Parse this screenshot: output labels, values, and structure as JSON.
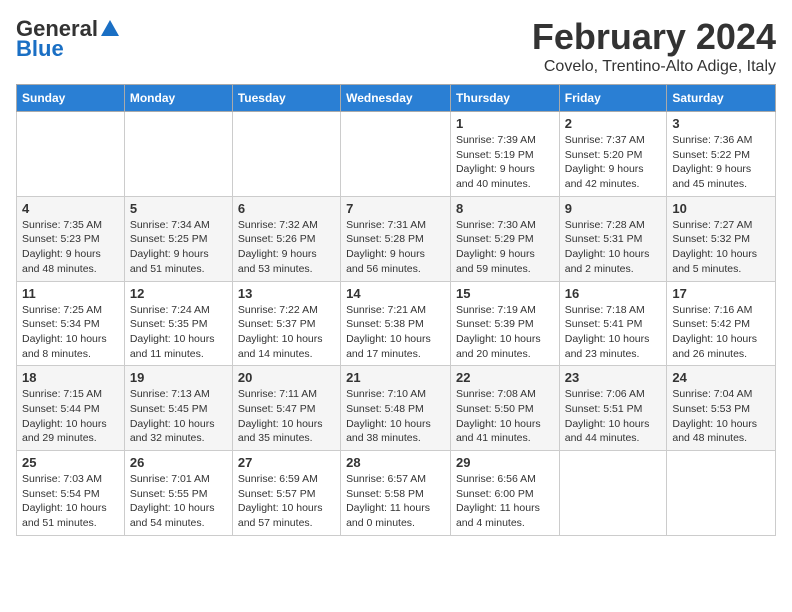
{
  "header": {
    "logo_general": "General",
    "logo_blue": "Blue",
    "month_title": "February 2024",
    "subtitle": "Covelo, Trentino-Alto Adige, Italy"
  },
  "days_of_week": [
    "Sunday",
    "Monday",
    "Tuesday",
    "Wednesday",
    "Thursday",
    "Friday",
    "Saturday"
  ],
  "weeks": [
    [
      {
        "day": "",
        "info": ""
      },
      {
        "day": "",
        "info": ""
      },
      {
        "day": "",
        "info": ""
      },
      {
        "day": "",
        "info": ""
      },
      {
        "day": "1",
        "info": "Sunrise: 7:39 AM\nSunset: 5:19 PM\nDaylight: 9 hours and 40 minutes."
      },
      {
        "day": "2",
        "info": "Sunrise: 7:37 AM\nSunset: 5:20 PM\nDaylight: 9 hours and 42 minutes."
      },
      {
        "day": "3",
        "info": "Sunrise: 7:36 AM\nSunset: 5:22 PM\nDaylight: 9 hours and 45 minutes."
      }
    ],
    [
      {
        "day": "4",
        "info": "Sunrise: 7:35 AM\nSunset: 5:23 PM\nDaylight: 9 hours and 48 minutes."
      },
      {
        "day": "5",
        "info": "Sunrise: 7:34 AM\nSunset: 5:25 PM\nDaylight: 9 hours and 51 minutes."
      },
      {
        "day": "6",
        "info": "Sunrise: 7:32 AM\nSunset: 5:26 PM\nDaylight: 9 hours and 53 minutes."
      },
      {
        "day": "7",
        "info": "Sunrise: 7:31 AM\nSunset: 5:28 PM\nDaylight: 9 hours and 56 minutes."
      },
      {
        "day": "8",
        "info": "Sunrise: 7:30 AM\nSunset: 5:29 PM\nDaylight: 9 hours and 59 minutes."
      },
      {
        "day": "9",
        "info": "Sunrise: 7:28 AM\nSunset: 5:31 PM\nDaylight: 10 hours and 2 minutes."
      },
      {
        "day": "10",
        "info": "Sunrise: 7:27 AM\nSunset: 5:32 PM\nDaylight: 10 hours and 5 minutes."
      }
    ],
    [
      {
        "day": "11",
        "info": "Sunrise: 7:25 AM\nSunset: 5:34 PM\nDaylight: 10 hours and 8 minutes."
      },
      {
        "day": "12",
        "info": "Sunrise: 7:24 AM\nSunset: 5:35 PM\nDaylight: 10 hours and 11 minutes."
      },
      {
        "day": "13",
        "info": "Sunrise: 7:22 AM\nSunset: 5:37 PM\nDaylight: 10 hours and 14 minutes."
      },
      {
        "day": "14",
        "info": "Sunrise: 7:21 AM\nSunset: 5:38 PM\nDaylight: 10 hours and 17 minutes."
      },
      {
        "day": "15",
        "info": "Sunrise: 7:19 AM\nSunset: 5:39 PM\nDaylight: 10 hours and 20 minutes."
      },
      {
        "day": "16",
        "info": "Sunrise: 7:18 AM\nSunset: 5:41 PM\nDaylight: 10 hours and 23 minutes."
      },
      {
        "day": "17",
        "info": "Sunrise: 7:16 AM\nSunset: 5:42 PM\nDaylight: 10 hours and 26 minutes."
      }
    ],
    [
      {
        "day": "18",
        "info": "Sunrise: 7:15 AM\nSunset: 5:44 PM\nDaylight: 10 hours and 29 minutes."
      },
      {
        "day": "19",
        "info": "Sunrise: 7:13 AM\nSunset: 5:45 PM\nDaylight: 10 hours and 32 minutes."
      },
      {
        "day": "20",
        "info": "Sunrise: 7:11 AM\nSunset: 5:47 PM\nDaylight: 10 hours and 35 minutes."
      },
      {
        "day": "21",
        "info": "Sunrise: 7:10 AM\nSunset: 5:48 PM\nDaylight: 10 hours and 38 minutes."
      },
      {
        "day": "22",
        "info": "Sunrise: 7:08 AM\nSunset: 5:50 PM\nDaylight: 10 hours and 41 minutes."
      },
      {
        "day": "23",
        "info": "Sunrise: 7:06 AM\nSunset: 5:51 PM\nDaylight: 10 hours and 44 minutes."
      },
      {
        "day": "24",
        "info": "Sunrise: 7:04 AM\nSunset: 5:53 PM\nDaylight: 10 hours and 48 minutes."
      }
    ],
    [
      {
        "day": "25",
        "info": "Sunrise: 7:03 AM\nSunset: 5:54 PM\nDaylight: 10 hours and 51 minutes."
      },
      {
        "day": "26",
        "info": "Sunrise: 7:01 AM\nSunset: 5:55 PM\nDaylight: 10 hours and 54 minutes."
      },
      {
        "day": "27",
        "info": "Sunrise: 6:59 AM\nSunset: 5:57 PM\nDaylight: 10 hours and 57 minutes."
      },
      {
        "day": "28",
        "info": "Sunrise: 6:57 AM\nSunset: 5:58 PM\nDaylight: 11 hours and 0 minutes."
      },
      {
        "day": "29",
        "info": "Sunrise: 6:56 AM\nSunset: 6:00 PM\nDaylight: 11 hours and 4 minutes."
      },
      {
        "day": "",
        "info": ""
      },
      {
        "day": "",
        "info": ""
      }
    ]
  ]
}
